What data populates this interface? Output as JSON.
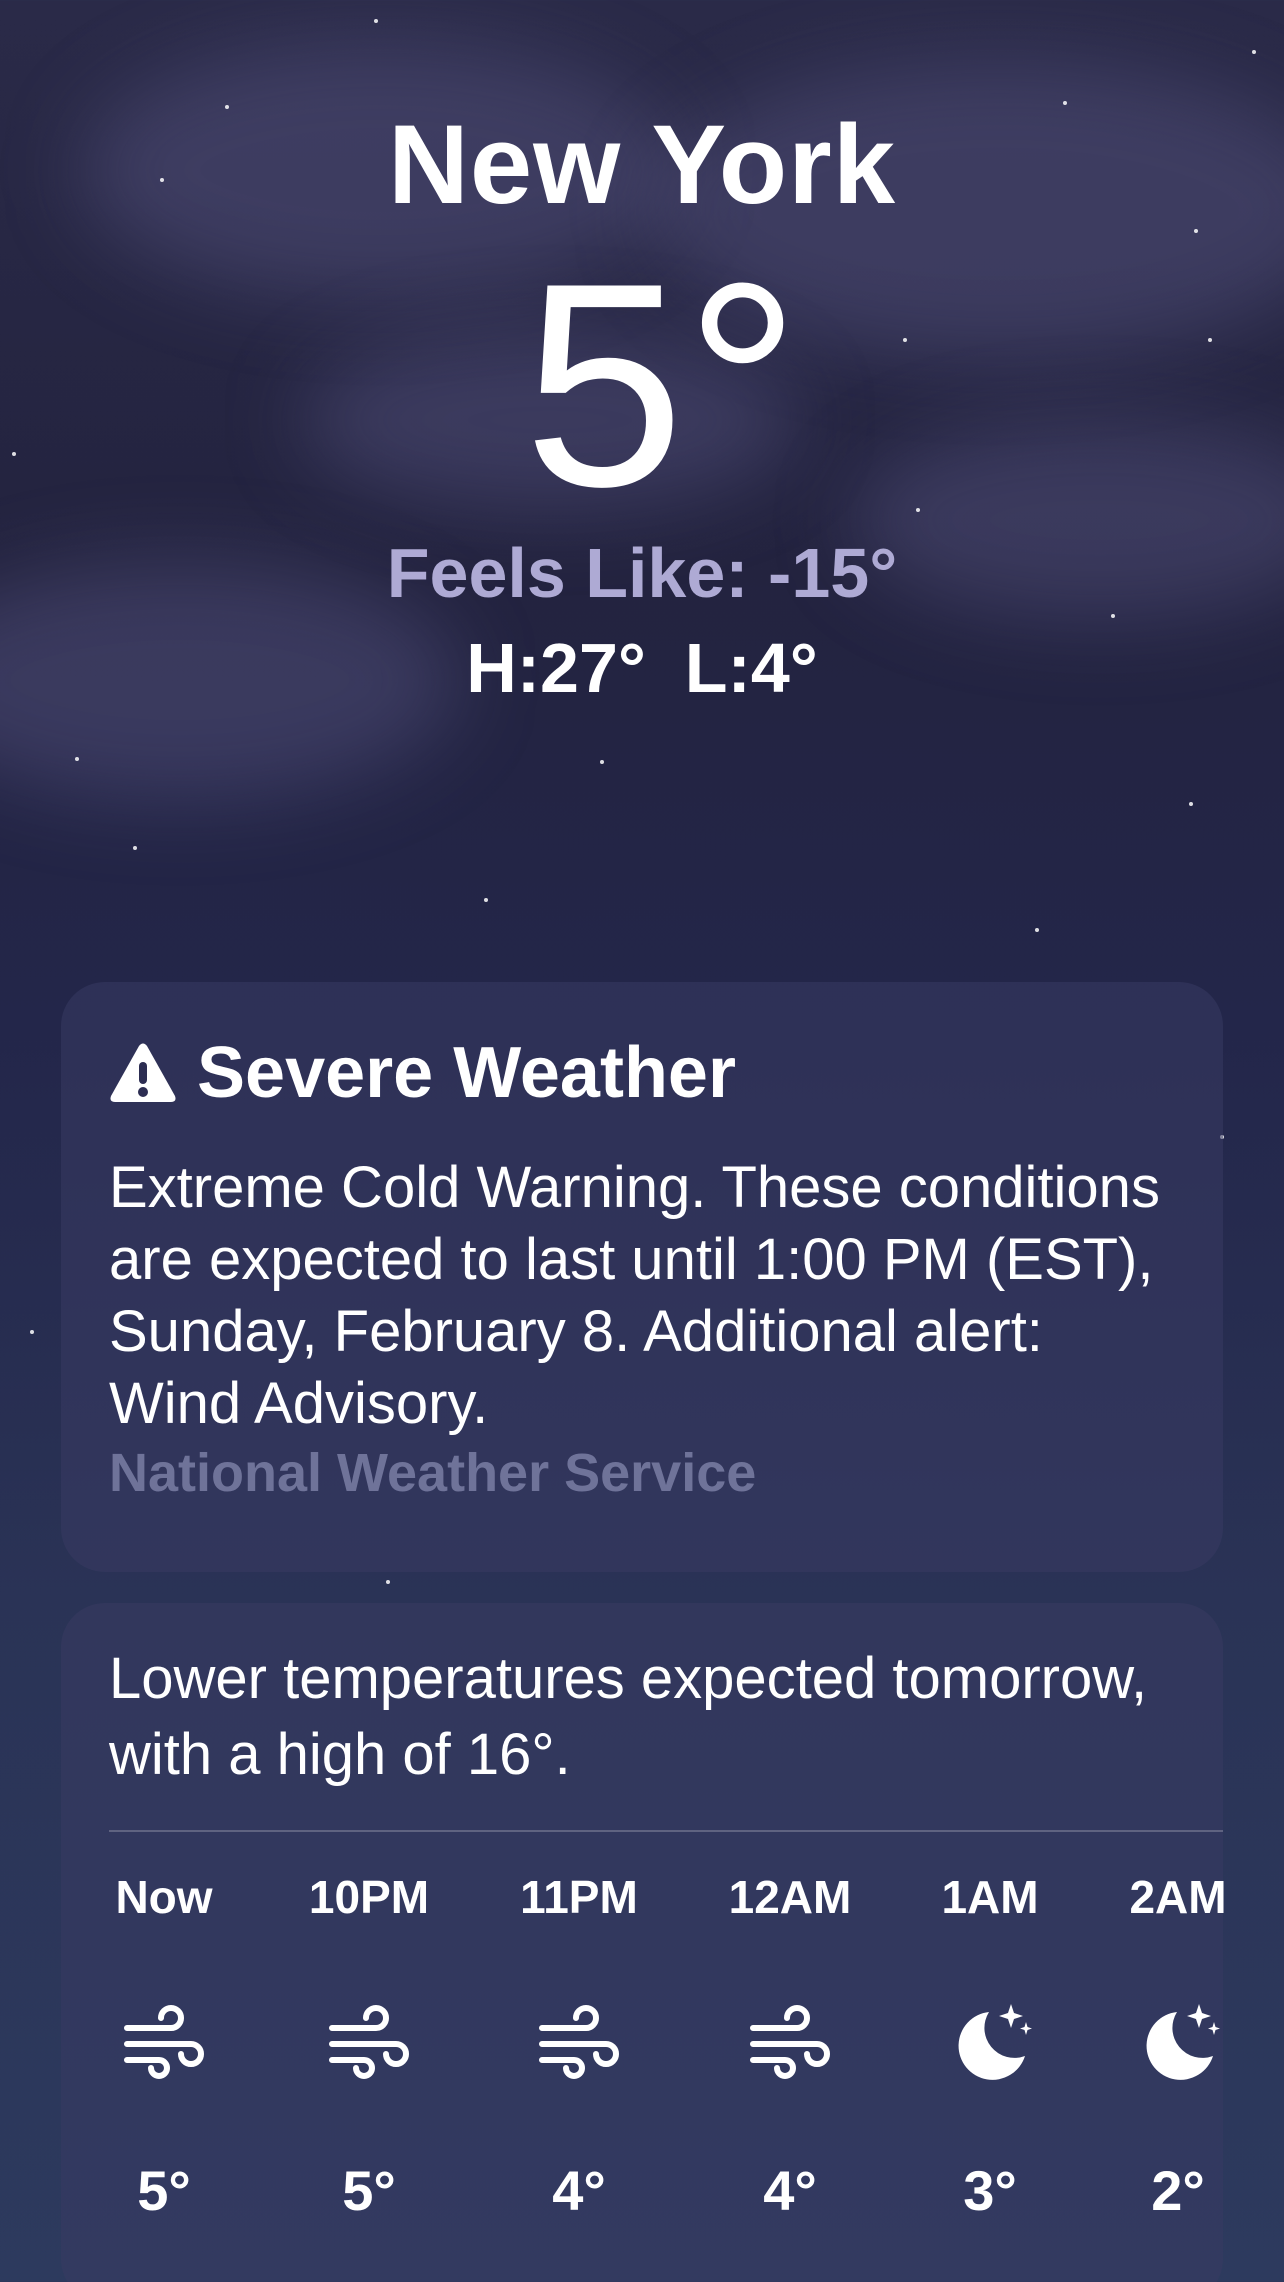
{
  "location": {
    "city": "New York",
    "temperature": "5°",
    "feels_like": "Feels Like: -15°",
    "high_low": "H:27°  L:4°"
  },
  "alert": {
    "icon": "warning-triangle-icon",
    "title": "Severe Weather",
    "text": "Extreme Cold Warning. These conditions are expected to last until 1:00 PM (EST), Sunday, February 8. Additional alert: Wind Advisory.",
    "source": "National Weather Service"
  },
  "hourly": {
    "summary": "Lower temperatures expected tomorrow, with a high of 16°.",
    "items": [
      {
        "label": "Now",
        "icon": "wind-icon",
        "temp": "5°"
      },
      {
        "label": "10PM",
        "icon": "wind-icon",
        "temp": "5°"
      },
      {
        "label": "11PM",
        "icon": "wind-icon",
        "temp": "4°"
      },
      {
        "label": "12AM",
        "icon": "wind-icon",
        "temp": "4°"
      },
      {
        "label": "1AM",
        "icon": "moon-stars-icon",
        "temp": "3°"
      },
      {
        "label": "2AM",
        "icon": "moon-stars-icon",
        "temp": "2°"
      }
    ]
  },
  "colors": {
    "background_top": "#2a2a48",
    "background_bottom": "#2d3a5e",
    "feels_like_text": "#aeaad4",
    "source_text": "#6f7399"
  }
}
